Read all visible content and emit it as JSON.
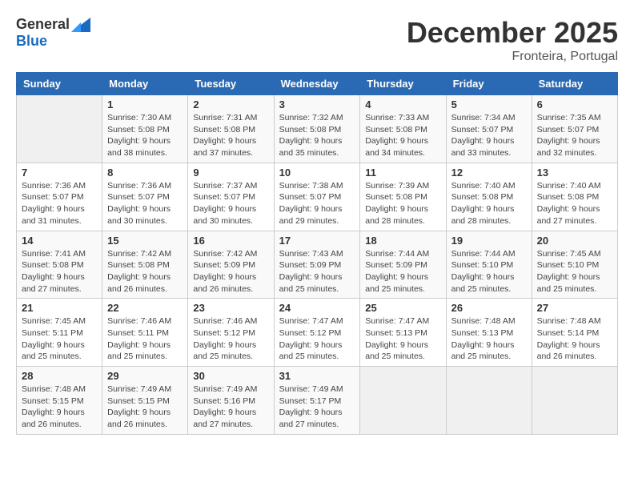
{
  "header": {
    "logo_general": "General",
    "logo_blue": "Blue",
    "month_title": "December 2025",
    "subtitle": "Fronteira, Portugal"
  },
  "weekdays": [
    "Sunday",
    "Monday",
    "Tuesday",
    "Wednesday",
    "Thursday",
    "Friday",
    "Saturday"
  ],
  "weeks": [
    [
      {
        "day": "",
        "info": ""
      },
      {
        "day": "1",
        "info": "Sunrise: 7:30 AM\nSunset: 5:08 PM\nDaylight: 9 hours\nand 38 minutes."
      },
      {
        "day": "2",
        "info": "Sunrise: 7:31 AM\nSunset: 5:08 PM\nDaylight: 9 hours\nand 37 minutes."
      },
      {
        "day": "3",
        "info": "Sunrise: 7:32 AM\nSunset: 5:08 PM\nDaylight: 9 hours\nand 35 minutes."
      },
      {
        "day": "4",
        "info": "Sunrise: 7:33 AM\nSunset: 5:08 PM\nDaylight: 9 hours\nand 34 minutes."
      },
      {
        "day": "5",
        "info": "Sunrise: 7:34 AM\nSunset: 5:07 PM\nDaylight: 9 hours\nand 33 minutes."
      },
      {
        "day": "6",
        "info": "Sunrise: 7:35 AM\nSunset: 5:07 PM\nDaylight: 9 hours\nand 32 minutes."
      }
    ],
    [
      {
        "day": "7",
        "info": "Sunrise: 7:36 AM\nSunset: 5:07 PM\nDaylight: 9 hours\nand 31 minutes."
      },
      {
        "day": "8",
        "info": "Sunrise: 7:36 AM\nSunset: 5:07 PM\nDaylight: 9 hours\nand 30 minutes."
      },
      {
        "day": "9",
        "info": "Sunrise: 7:37 AM\nSunset: 5:07 PM\nDaylight: 9 hours\nand 30 minutes."
      },
      {
        "day": "10",
        "info": "Sunrise: 7:38 AM\nSunset: 5:07 PM\nDaylight: 9 hours\nand 29 minutes."
      },
      {
        "day": "11",
        "info": "Sunrise: 7:39 AM\nSunset: 5:08 PM\nDaylight: 9 hours\nand 28 minutes."
      },
      {
        "day": "12",
        "info": "Sunrise: 7:40 AM\nSunset: 5:08 PM\nDaylight: 9 hours\nand 28 minutes."
      },
      {
        "day": "13",
        "info": "Sunrise: 7:40 AM\nSunset: 5:08 PM\nDaylight: 9 hours\nand 27 minutes."
      }
    ],
    [
      {
        "day": "14",
        "info": "Sunrise: 7:41 AM\nSunset: 5:08 PM\nDaylight: 9 hours\nand 27 minutes."
      },
      {
        "day": "15",
        "info": "Sunrise: 7:42 AM\nSunset: 5:08 PM\nDaylight: 9 hours\nand 26 minutes."
      },
      {
        "day": "16",
        "info": "Sunrise: 7:42 AM\nSunset: 5:09 PM\nDaylight: 9 hours\nand 26 minutes."
      },
      {
        "day": "17",
        "info": "Sunrise: 7:43 AM\nSunset: 5:09 PM\nDaylight: 9 hours\nand 25 minutes."
      },
      {
        "day": "18",
        "info": "Sunrise: 7:44 AM\nSunset: 5:09 PM\nDaylight: 9 hours\nand 25 minutes."
      },
      {
        "day": "19",
        "info": "Sunrise: 7:44 AM\nSunset: 5:10 PM\nDaylight: 9 hours\nand 25 minutes."
      },
      {
        "day": "20",
        "info": "Sunrise: 7:45 AM\nSunset: 5:10 PM\nDaylight: 9 hours\nand 25 minutes."
      }
    ],
    [
      {
        "day": "21",
        "info": "Sunrise: 7:45 AM\nSunset: 5:11 PM\nDaylight: 9 hours\nand 25 minutes."
      },
      {
        "day": "22",
        "info": "Sunrise: 7:46 AM\nSunset: 5:11 PM\nDaylight: 9 hours\nand 25 minutes."
      },
      {
        "day": "23",
        "info": "Sunrise: 7:46 AM\nSunset: 5:12 PM\nDaylight: 9 hours\nand 25 minutes."
      },
      {
        "day": "24",
        "info": "Sunrise: 7:47 AM\nSunset: 5:12 PM\nDaylight: 9 hours\nand 25 minutes."
      },
      {
        "day": "25",
        "info": "Sunrise: 7:47 AM\nSunset: 5:13 PM\nDaylight: 9 hours\nand 25 minutes."
      },
      {
        "day": "26",
        "info": "Sunrise: 7:48 AM\nSunset: 5:13 PM\nDaylight: 9 hours\nand 25 minutes."
      },
      {
        "day": "27",
        "info": "Sunrise: 7:48 AM\nSunset: 5:14 PM\nDaylight: 9 hours\nand 26 minutes."
      }
    ],
    [
      {
        "day": "28",
        "info": "Sunrise: 7:48 AM\nSunset: 5:15 PM\nDaylight: 9 hours\nand 26 minutes."
      },
      {
        "day": "29",
        "info": "Sunrise: 7:49 AM\nSunset: 5:15 PM\nDaylight: 9 hours\nand 26 minutes."
      },
      {
        "day": "30",
        "info": "Sunrise: 7:49 AM\nSunset: 5:16 PM\nDaylight: 9 hours\nand 27 minutes."
      },
      {
        "day": "31",
        "info": "Sunrise: 7:49 AM\nSunset: 5:17 PM\nDaylight: 9 hours\nand 27 minutes."
      },
      {
        "day": "",
        "info": ""
      },
      {
        "day": "",
        "info": ""
      },
      {
        "day": "",
        "info": ""
      }
    ]
  ]
}
